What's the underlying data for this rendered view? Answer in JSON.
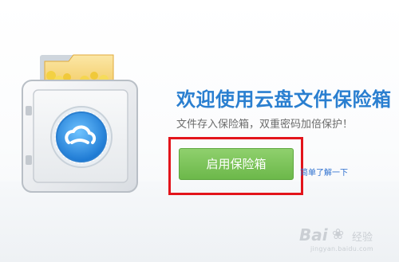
{
  "page": {
    "title": "欢迎使用云盘文件保险箱",
    "subtitle": "文件存入保险箱，双重密码加倍保护！",
    "enable_button": "启用保险箱",
    "learn_more_link": "简单了解一下"
  },
  "watermark": {
    "logo_text": "Bai",
    "paw_glyph": "❀",
    "sub_text": "经验",
    "url": "jingyan.baidu.com"
  },
  "icons": {
    "safe": "safe-icon",
    "cloud": "cloud-icon",
    "folder": "folder-icon"
  },
  "colors": {
    "title": "#2a7fd0",
    "button": "#7cc45a",
    "highlight_frame": "#e3141b",
    "link": "#2c6fcf"
  }
}
